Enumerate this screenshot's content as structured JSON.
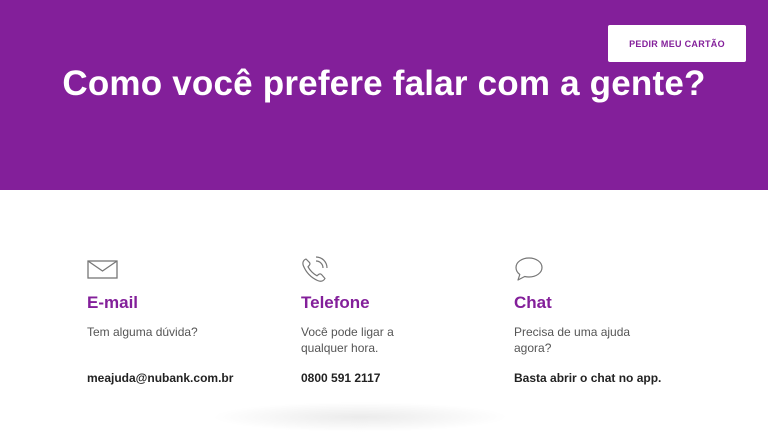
{
  "header": {
    "cta_label": "PEDIR MEU CARTÃO",
    "title": "Como você prefere falar com a gente?",
    "background_color": "#831f9a"
  },
  "contact_options": [
    {
      "icon": "envelope-icon",
      "title": "E-mail",
      "description": "Tem alguma dúvida?",
      "detail": "meajuda@nubank.com.br"
    },
    {
      "icon": "phone-icon",
      "title": "Telefone",
      "description": "Você pode ligar a qualquer hora.",
      "detail": "0800 591 2117"
    },
    {
      "icon": "chat-bubble-icon",
      "title": "Chat",
      "description": "Precisa de uma ajuda agora?",
      "detail": "Basta abrir o chat no app."
    }
  ],
  "colors": {
    "accent": "#831f9a",
    "text": "#555555",
    "text_strong": "#222222"
  }
}
